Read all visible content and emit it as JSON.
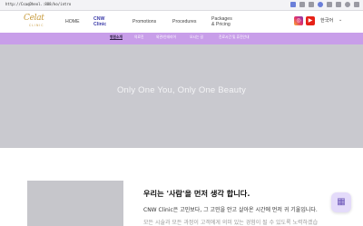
{
  "browser": {
    "url": "http://CsaqDheol.:888/ko/intro"
  },
  "header": {
    "logo_text": "Celat",
    "logo_sub": "CLINIC",
    "nav": [
      {
        "label": "HOME"
      },
      {
        "label": "CNW Clinic"
      },
      {
        "label": "Promotions"
      },
      {
        "label": "Procedures"
      },
      {
        "label": "Packages & Pricing"
      }
    ],
    "instagram_icon": "instagram-icon",
    "youtube_icon": "youtube-icon",
    "language": "한국어",
    "language_chevron": "⌄"
  },
  "subnav": {
    "items": [
      {
        "label": "병원소개"
      },
      {
        "label": "의료진"
      },
      {
        "label": "외관/인테리어"
      },
      {
        "label": "오시는 길"
      },
      {
        "label": "진료시간 및 휴진안내"
      }
    ]
  },
  "hero": {
    "title": "Only One You, Only One Beauty"
  },
  "intro": {
    "heading": "우리는 '사람'을 먼저 생각 합니다.",
    "body": "CNW Clinic은 고민보다, 그 고민을 안고 살아온 시간에 먼저 귀 기울입니다.",
    "body_faded": "모든 시술과 모든 과정이 고객에게 의미 있는 경험이 될 수 있도록 노력하겠습"
  },
  "float_button": {
    "icon": "calendar-icon"
  },
  "colors": {
    "accent_purple": "#c89ee9",
    "brand_gold": "#c79a3b",
    "nav_active": "#3a3aa8"
  }
}
